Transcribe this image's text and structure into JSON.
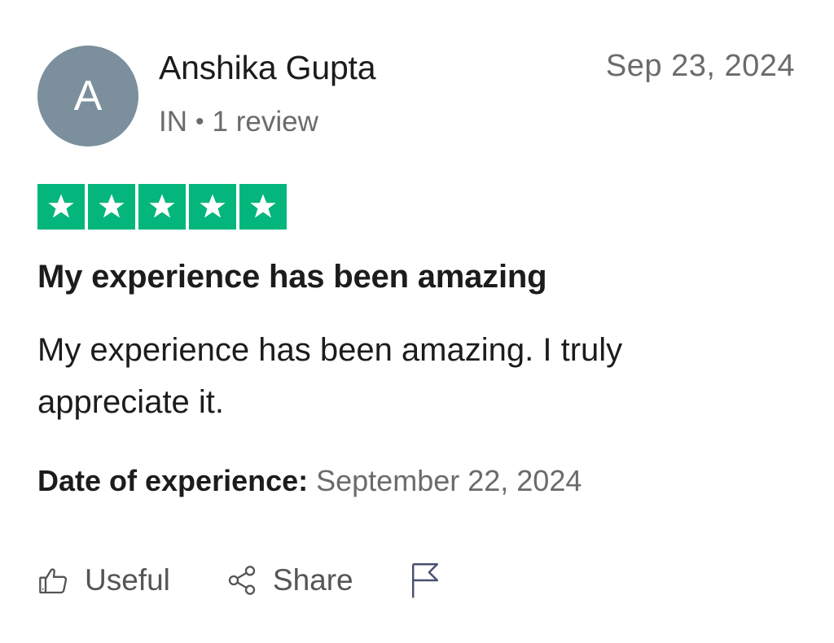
{
  "review": {
    "avatar_initial": "A",
    "reviewer_name": "Anshika Gupta",
    "country": "IN",
    "separator": "•",
    "review_count": "1 review",
    "date": "Sep 23, 2024",
    "rating": 5,
    "rating_max": 5,
    "title": "My experience has been amazing",
    "body": "My experience has been amazing. I truly appreciate it.",
    "experience_label": "Date of experience:",
    "experience_date": "September 22, 2024"
  },
  "actions": {
    "useful_label": "Useful",
    "share_label": "Share"
  },
  "colors": {
    "star_green": "#04b67b",
    "avatar_bg": "#7b8f9c",
    "muted_text": "#6b6b6b"
  },
  "icons": {
    "useful": "thumbs-up-icon",
    "share": "share-icon",
    "report": "flag-icon",
    "star": "star-icon"
  }
}
